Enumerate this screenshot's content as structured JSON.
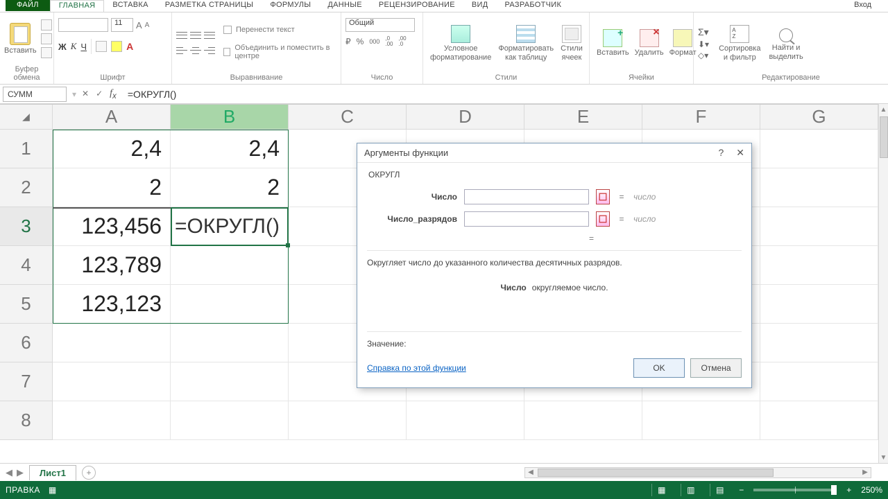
{
  "tabs": {
    "file": "ФАЙЛ",
    "items": [
      "ГЛАВНАЯ",
      "ВСТАВКА",
      "РАЗМЕТКА СТРАНИЦЫ",
      "ФОРМУЛЫ",
      "ДАННЫЕ",
      "РЕЦЕНЗИРОВАНИЕ",
      "ВИД",
      "РАЗРАБОТЧИК"
    ],
    "active": 0,
    "signin": "Вход"
  },
  "ribbon": {
    "clipboard": {
      "paste": "Вставить",
      "label": "Буфер обмена"
    },
    "font": {
      "size": "11",
      "label": "Шрифт",
      "bold": "Ж",
      "italic": "К",
      "underline": "Ч"
    },
    "alignment": {
      "wrap": "Перенести текст",
      "merge": "Объединить и поместить в центре",
      "label": "Выравнивание"
    },
    "number": {
      "format": "Общий",
      "label": "Число",
      "percent": "%",
      "comma": "000",
      "inc": ",0\n.00",
      "dec": ",00\n.0"
    },
    "styles": {
      "cond": "Условное\nформатирование",
      "table": "Форматировать\nкак таблицу",
      "cell": "Стили\nячеек",
      "label": "Стили"
    },
    "cells": {
      "insert": "Вставить",
      "delete": "Удалить",
      "format": "Формат",
      "label": "Ячейки"
    },
    "editing": {
      "sort": "Сортировка\nи фильтр",
      "find": "Найти и\nвыделить",
      "label": "Редактирование"
    }
  },
  "formula_bar": {
    "name_box": "СУММ",
    "formula": "=ОКРУГЛ()"
  },
  "grid": {
    "columns": [
      "A",
      "B",
      "C",
      "D",
      "E",
      "F",
      "G"
    ],
    "rows": [
      "1",
      "2",
      "3",
      "4",
      "5",
      "6",
      "7",
      "8"
    ],
    "cells": {
      "A1": "2,4",
      "B1": "2,4",
      "A2": "2",
      "B2": "2",
      "A3": "123,456",
      "B3": "=ОКРУГЛ()",
      "A4": "123,789",
      "A5": "123,123"
    },
    "selected_col": "B",
    "active_row": "3"
  },
  "dialog": {
    "title": "Аргументы функции",
    "func": "ОКРУГЛ",
    "args": [
      {
        "label": "Число",
        "hint": "число"
      },
      {
        "label": "Число_разрядов",
        "hint": "число"
      }
    ],
    "eq": "=",
    "description": "Округляет число до указанного количества десятичных разрядов.",
    "arg_name": "Число",
    "arg_desc": "округляемое число.",
    "value_label": "Значение:",
    "help": "Справка по этой функции",
    "ok": "OK",
    "cancel": "Отмена"
  },
  "sheets": {
    "active": "Лист1"
  },
  "status": {
    "mode": "ПРАВКА",
    "zoom": "250%"
  }
}
